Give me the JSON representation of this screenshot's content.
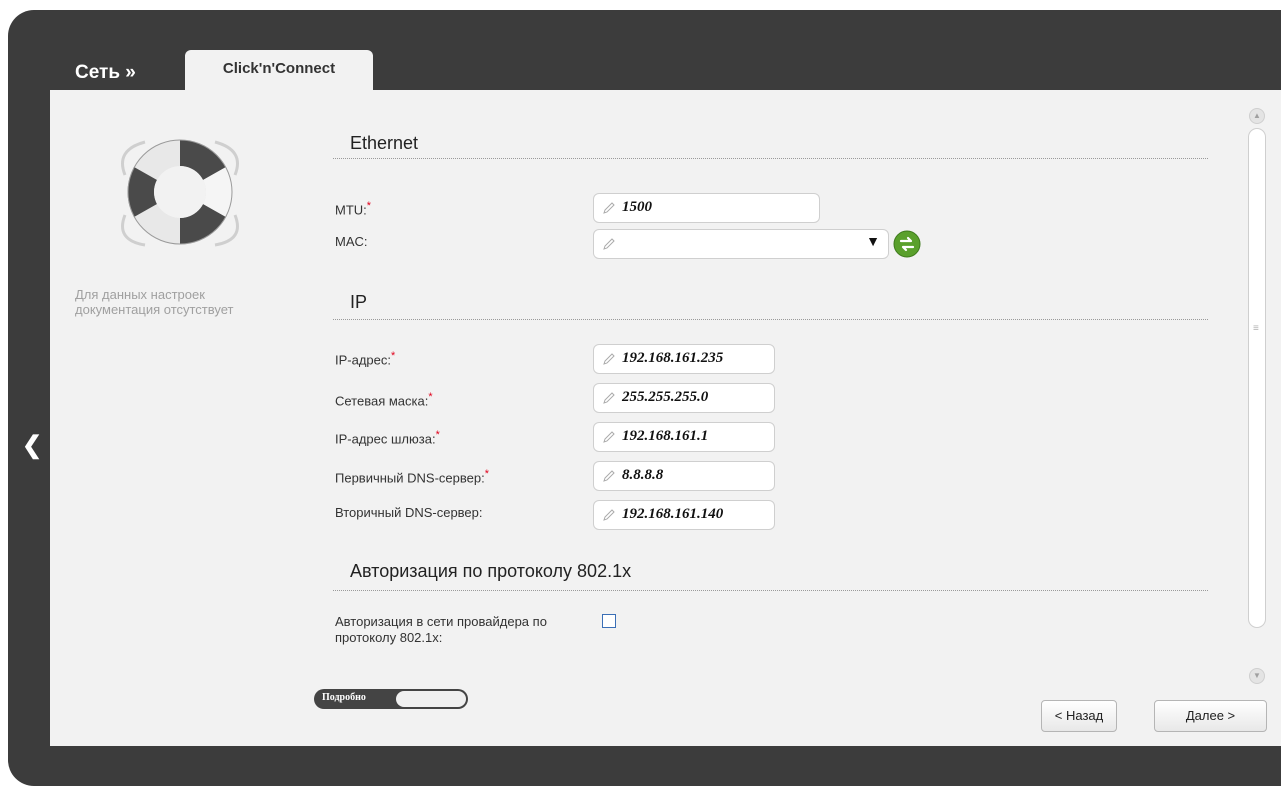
{
  "header": {
    "breadcrumb": "Сеть »",
    "tab_label": "Click'n'Connect"
  },
  "sidebar": {
    "no_docs_text": "Для данных настроек документация отсутствует"
  },
  "sections": {
    "ethernet": {
      "title": "Ethernet",
      "mtu_label": "MTU:",
      "mtu_value": "1500",
      "mac_label": "MAC:",
      "mac_value": ""
    },
    "ip": {
      "title": "IP",
      "ip_label": "IP-адрес:",
      "ip_value": "192.168.161.235",
      "mask_label": "Сетевая маска:",
      "mask_value": "255.255.255.0",
      "gateway_label": "IP-адрес шлюза:",
      "gateway_value": "192.168.161.1",
      "dns1_label": "Первичный DNS-сервер:",
      "dns1_value": "8.8.8.8",
      "dns2_label": "Вторичный DNS-сервер:",
      "dns2_value": "192.168.161.140"
    },
    "auth": {
      "title": "Авторизация по протоколу 802.1x",
      "checkbox_label": "Авторизация в сети провайдера по протоколу 802.1x:",
      "checked": false
    }
  },
  "required_mark": "*",
  "toggle": {
    "label": "Подробно"
  },
  "buttons": {
    "back": "< Назад",
    "next": "Далее >"
  },
  "colors": {
    "frame": "#3c3c3c",
    "panel": "#f2f2f2",
    "required": "#e0001b",
    "accent_green": "#5aa02c"
  },
  "icons": {
    "back_arrow": "chevron-left-icon",
    "pencil": "pencil-icon",
    "refresh": "refresh-icon",
    "dropdown": "dropdown-arrow-icon",
    "lifebuoy": "lifebuoy-icon"
  }
}
